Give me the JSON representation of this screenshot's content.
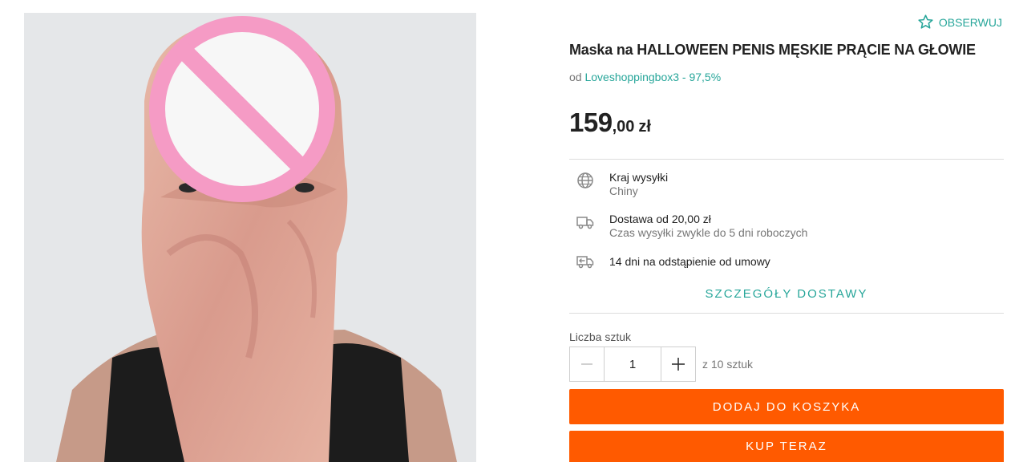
{
  "product": {
    "image_alt": "product photo",
    "title": "Maska na HALLOWEEN PENIS MĘSKIE PRĄCIE NA GŁOWIE",
    "watch_label": "OBSERWUJ",
    "seller_prefix": "od",
    "seller_name": "Loveshoppingbox3 - 97,5%"
  },
  "price": {
    "integer": "159",
    "decimal": ",00",
    "currency": "zł"
  },
  "shipping": {
    "country_label": "Kraj wysyłki",
    "country_value": "Chiny",
    "delivery_label": "Dostawa od 20,00 zł",
    "delivery_time": "Czas wysyłki zwykle do 5 dni roboczych",
    "returns": "14 dni na odstąpienie od umowy",
    "details_link": "SZCZEGÓŁY DOSTAWY"
  },
  "quantity": {
    "label": "Liczba sztuk",
    "value": "1",
    "of_total": "z 10 sztuk"
  },
  "actions": {
    "add_to_cart": "DODAJ DO KOSZYKA",
    "buy_now": "KUP TERAZ"
  },
  "colors": {
    "accent": "#27a69a",
    "cta": "#ff5a00"
  },
  "icons": [
    "star-outline-icon",
    "globe-icon",
    "truck-icon",
    "return-icon",
    "minus-icon",
    "plus-icon",
    "prohibited-censor-icon"
  ]
}
